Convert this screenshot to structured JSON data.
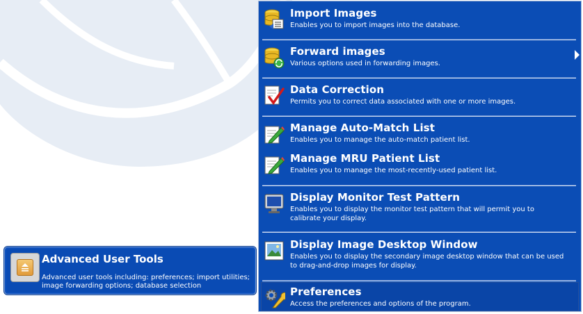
{
  "advanced_tile": {
    "title": "Advanced User Tools",
    "description": "Advanced user tools including: preferences; import utilities; image forwarding options; database selection",
    "icon": "advanced-tools-icon"
  },
  "menu": {
    "items": [
      {
        "title": "Import Images",
        "description": "Enables you to import images into the database.",
        "icon": "import-database-icon"
      },
      {
        "title": "Forward images",
        "description": "Various options used in forwarding images.",
        "icon": "forward-database-icon",
        "has_submenu": true
      },
      {
        "title": "Data Correction",
        "description": "Permits you to correct data associated with one or more images.",
        "icon": "checkmark-document-icon"
      },
      {
        "title": "Manage Auto-Match List",
        "description": "Enables you to manage the auto-match patient list.",
        "icon": "pencil-edit-icon"
      },
      {
        "title": "Manage MRU Patient List",
        "description": "Enables you to manage the most-recently-used patient list.",
        "icon": "pencil-edit-icon"
      },
      {
        "title": "Display Monitor Test Pattern",
        "description": "Enables you to display the monitor test pattern that will permit you to calibrate your display.",
        "icon": "monitor-icon"
      },
      {
        "title": "Display Image Desktop Window",
        "description": "Enables you to display the secondary image desktop window that can be used to drag-and-drop images for display.",
        "icon": "image-window-icon"
      },
      {
        "title": "Preferences",
        "description": "Access the preferences and options of the program.",
        "icon": "gear-wrench-icon"
      }
    ]
  },
  "colors": {
    "menu_bg": "#0b4db5",
    "text": "#ffffff",
    "accent_highlight": "#0a45a7"
  }
}
